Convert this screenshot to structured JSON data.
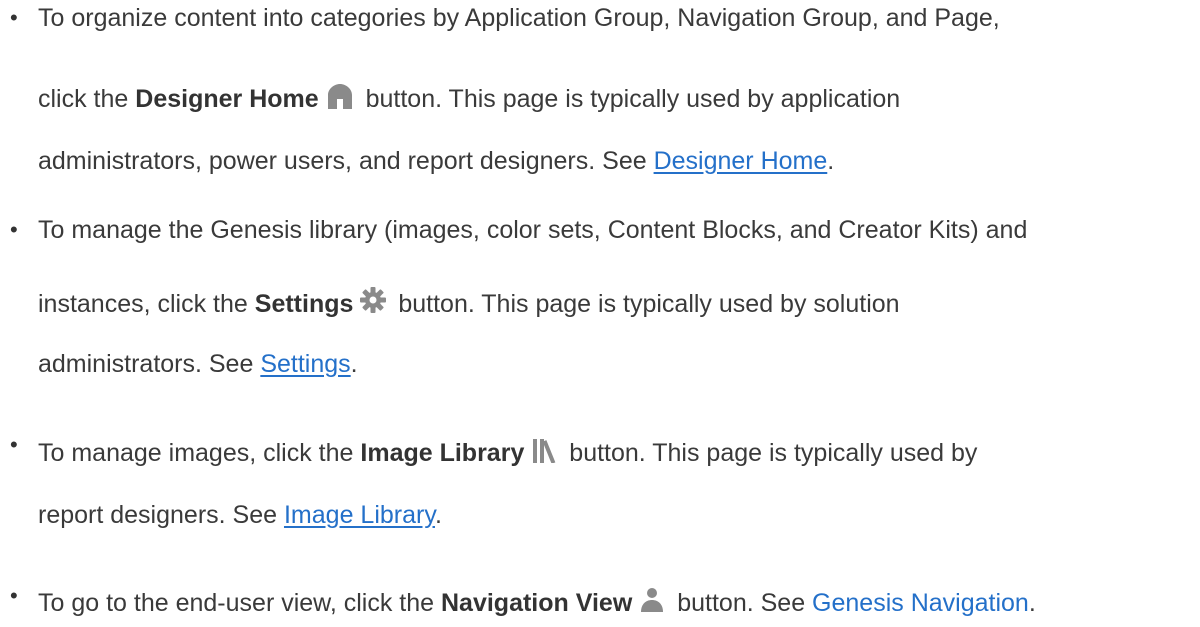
{
  "items": [
    {
      "l1": "To organize content into categories by Application Group, Navigation Group, and Page,",
      "pre": "click the ",
      "strong": "Designer Home",
      "icon": "home-icon",
      "post": " button. This page is typically used by application",
      "l3pre": "administrators, power users, and report designers. See ",
      "link": "Designer Home",
      "end": "."
    },
    {
      "l1": "To manage the Genesis library (images, color sets, Content Blocks, and Creator Kits) and",
      "pre": "instances, click the ",
      "strong": "Settings",
      "icon": "gear-icon",
      "post": " button. This page is typically used by solution",
      "l3pre": "administrators. See ",
      "link": "Settings",
      "end": "."
    },
    {
      "pre": "To manage images, click the ",
      "strong": "Image Library",
      "icon": "library-icon",
      "post": " button. This page is typically used by",
      "l2pre": "report designers. See ",
      "link": "Image Library",
      "end": "."
    },
    {
      "pre": "To go to the end-user view, click the ",
      "strong": "Navigation View",
      "icon": "user-icon",
      "post": " button. See ",
      "link": "Genesis Navigation",
      "end": "."
    }
  ],
  "colors": {
    "text": "#3a3a3a",
    "link": "#2470c9",
    "icon": "#8a8a8a"
  }
}
